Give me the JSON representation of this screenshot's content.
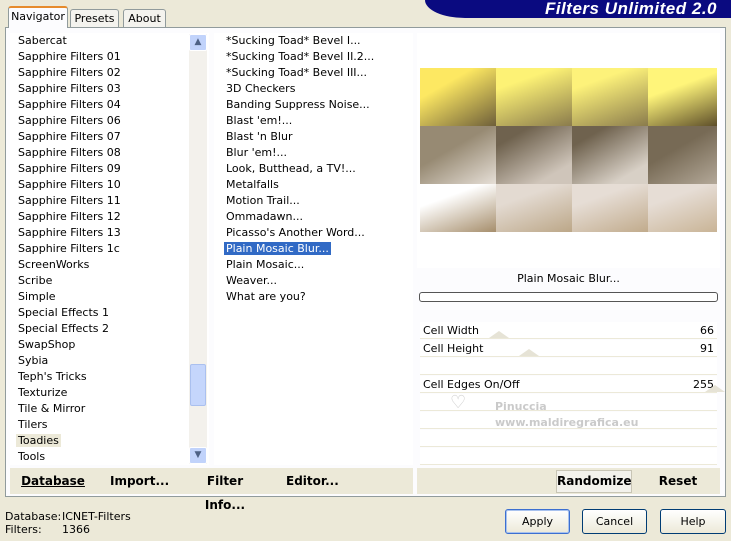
{
  "header": {
    "title": "Filters Unlimited 2.0"
  },
  "tabs": [
    {
      "label": "Navigator"
    },
    {
      "label": "Presets"
    },
    {
      "label": "About"
    }
  ],
  "categories": {
    "items": [
      "Sabercat",
      "Sapphire Filters 01",
      "Sapphire Filters 02",
      "Sapphire Filters 03",
      "Sapphire Filters 04",
      "Sapphire Filters 06",
      "Sapphire Filters 07",
      "Sapphire Filters 08",
      "Sapphire Filters 09",
      "Sapphire Filters 10",
      "Sapphire Filters 11",
      "Sapphire Filters 12",
      "Sapphire Filters 13",
      "Sapphire Filters 1c",
      "ScreenWorks",
      "Scribe",
      "Simple",
      "Special Effects 1",
      "Special Effects 2",
      "SwapShop",
      "Sybia",
      "Teph's Tricks",
      "Texturize",
      "Tile & Mirror",
      "Tilers",
      "Toadies",
      "Tools"
    ],
    "selected": "Toadies"
  },
  "filters": {
    "items": [
      "*Sucking Toad*  Bevel I...",
      "*Sucking Toad*  Bevel II.2...",
      "*Sucking Toad*  Bevel III...",
      "3D Checkers",
      "Banding Suppress Noise...",
      "Blast 'em!...",
      "Blast 'n Blur",
      "Blur 'em!...",
      "Look, Butthead, a TV!...",
      "Metalfalls",
      "Motion Trail...",
      "Ommadawn...",
      "Picasso's Another Word...",
      "Plain Mosaic Blur...",
      "Plain Mosaic...",
      "Weaver...",
      "What are you?"
    ],
    "selected": "Plain Mosaic Blur..."
  },
  "preview": {
    "filter_name": "Plain Mosaic Blur...",
    "progress": 0
  },
  "params": [
    {
      "label": "Cell Width",
      "value": "66",
      "level": 0.26
    },
    {
      "label": "Cell Height",
      "value": "91",
      "level": 0.36
    },
    {
      "label": "",
      "value": ""
    },
    {
      "label": "Cell Edges On/Off",
      "value": "255",
      "level": 1.0
    }
  ],
  "watermark": {
    "line1": "Pinuccia",
    "line2": "www.maldiregrafica.eu"
  },
  "left_buttons": {
    "database": "Database",
    "import": "Import...",
    "filter_info": "Filter Info...",
    "editor": "Editor..."
  },
  "right_buttons": {
    "randomize": "Randomize",
    "reset": "Reset"
  },
  "status": {
    "database_label": "Database:",
    "database_value": "ICNET-Filters",
    "filters_label": "Filters:",
    "filters_value": "1366"
  },
  "dialog_buttons": {
    "apply": "Apply",
    "cancel": "Cancel",
    "help": "Help"
  },
  "colors": {
    "selection": "#316ac5",
    "banner": "#0a0a80"
  }
}
